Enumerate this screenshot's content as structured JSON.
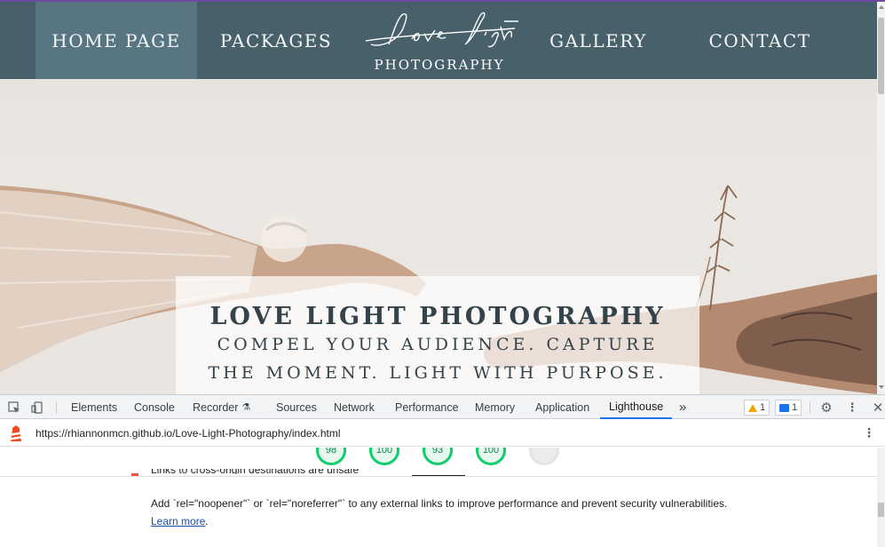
{
  "nav": {
    "home": "HOME PAGE",
    "packages": "PACKAGES",
    "gallery": "GALLERY",
    "contact": "CONTACT"
  },
  "logo": {
    "script": "Love Light",
    "word": "PHOTOGRAPHY"
  },
  "hero": {
    "title": "LOVE LIGHT PHOTOGRAPHY",
    "subtitle_line1": "COMPEL YOUR AUDIENCE. CAPTURE",
    "subtitle_line2": "THE MOMENT. LIGHT WITH PURPOSE."
  },
  "devtools": {
    "tabs": [
      "Elements",
      "Console",
      "Recorder",
      "Sources",
      "Network",
      "Performance",
      "Memory",
      "Application",
      "Lighthouse"
    ],
    "active_tab": "Lighthouse",
    "more": "»",
    "warning_count": "1",
    "message_count": "1",
    "url": "https://rhiannonmcn.github.io/Love-Light-Photography/index.html"
  },
  "lighthouse": {
    "scores": [
      "98",
      "100",
      "93",
      "100"
    ],
    "audit_desc": "Add `rel=\"noopener\"` or `rel=\"noreferrer\"` to any external links to improve performance and prevent security vulnerabilities.",
    "learn_more": "Learn more",
    "learn_more_suffix": ".",
    "cut_title": "Links to cross-origin destinations are unsafe"
  },
  "colors": {
    "nav_bg": "#48606a",
    "nav_active": "#577682",
    "score_pass": "#0cce6b",
    "accent": "#1a73e8"
  }
}
